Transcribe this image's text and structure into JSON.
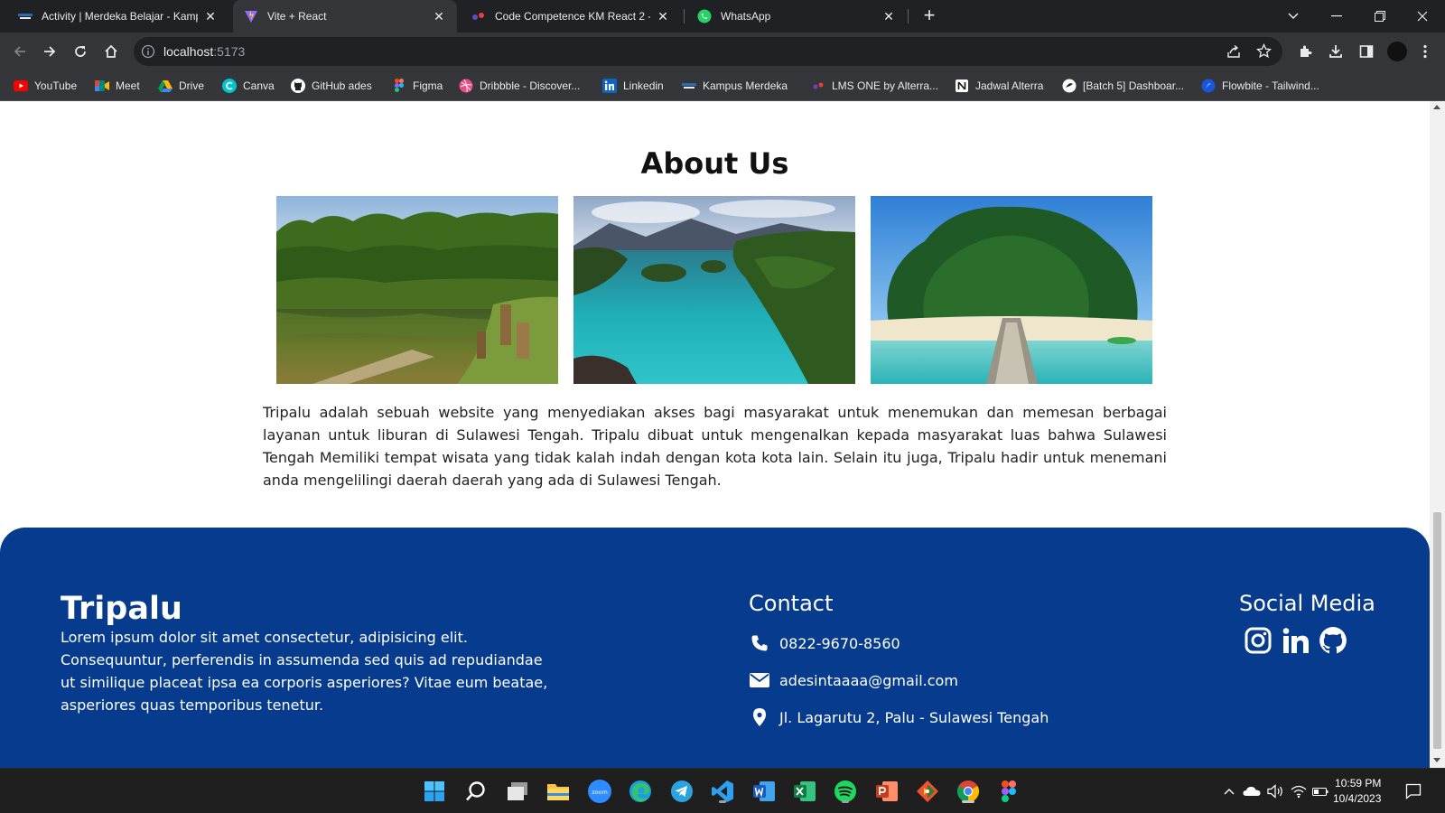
{
  "browser": {
    "tabs": [
      {
        "title": "Activity | Merdeka Belajar - Kamp",
        "favicon": "merdeka-logo",
        "active": false
      },
      {
        "title": "Vite + React",
        "favicon": "vite-logo",
        "active": true
      },
      {
        "title": "Code Competence KM React 2 -",
        "favicon": "alterra-logo",
        "active": false
      },
      {
        "title": "WhatsApp",
        "favicon": "whatsapp-logo",
        "active": false
      }
    ],
    "close_glyph": "✕",
    "new_tab_glyph": "+",
    "address": {
      "host": "localhost",
      "port": ":5173"
    },
    "bookmarks": [
      {
        "label": "YouTube",
        "icon": "youtube-icon",
        "color": "#ff0000"
      },
      {
        "label": "Meet",
        "icon": "meet-icon",
        "color": "#00897b"
      },
      {
        "label": "Drive",
        "icon": "drive-icon",
        "color": "#1fa463"
      },
      {
        "label": "Canva",
        "icon": "canva-icon",
        "color": "#00c4cc"
      },
      {
        "label": "GitHub ades",
        "icon": "github-icon",
        "color": "#ffffff"
      },
      {
        "label": "Figma",
        "icon": "figma-icon",
        "color": "#f24e1e"
      },
      {
        "label": "Dribbble - Discover...",
        "icon": "dribbble-icon",
        "color": "#ea4c89"
      },
      {
        "label": "Linkedin",
        "icon": "linkedin-icon",
        "color": "#0a66c2"
      },
      {
        "label": "Kampus Merdeka",
        "icon": "kampus-merdeka-icon",
        "color": "#2b6cb0"
      },
      {
        "label": "LMS ONE by Alterra...",
        "icon": "alterra-icon",
        "color": "#e53e3e"
      },
      {
        "label": "Jadwal Alterra",
        "icon": "notion-icon",
        "color": "#ffffff"
      },
      {
        "label": "[Batch 5] Dashboar...",
        "icon": "dashboard-icon",
        "color": "#ffffff"
      },
      {
        "label": "Flowbite - Tailwind...",
        "icon": "flowbite-icon",
        "color": "#1a56db"
      }
    ]
  },
  "page": {
    "about": {
      "title": "About Us",
      "text": "Tripalu adalah sebuah website yang menyediakan akses bagi masyarakat untuk menemukan dan memesan berbagai layanan untuk liburan di Sulawesi Tengah. Tripalu dibuat untuk mengenalkan kepada masyarakat luas bahwa Sulawesi Tengah Memiliki tempat wisata yang tidak kalah indah dengan kota kota lain. Selain itu juga, Tripalu hadir untuk menemani anda mengelilingi daerah daerah yang ada di Sulawesi Tengah."
    },
    "footer": {
      "brand": "Tripalu",
      "description": "Lorem ipsum dolor sit amet consectetur, adipisicing elit. Consequuntur, perferendis in assumenda sed quis ad repudiandae ut similique placeat ipsa ea corporis asperiores? Vitae eum beatae, asperiores quas temporibus tenetur.",
      "contact_title": "Contact",
      "phone": "0822-9670-8560",
      "email": "adesintaaaa@gmail.com",
      "address": "Jl. Lagarutu 2, Palu - Sulawesi Tengah",
      "social_title": "Social Media",
      "social": [
        "instagram-icon",
        "linkedin-icon",
        "github-icon"
      ]
    }
  },
  "taskbar": {
    "apps": [
      "windows-start-icon",
      "search-icon",
      "task-view-icon",
      "file-explorer-icon",
      "zoom-icon",
      "edge-icon",
      "telegram-icon",
      "vscode-icon",
      "word-icon",
      "excel-icon",
      "spotify-icon",
      "powerpoint-icon",
      "git-icon",
      "chrome-icon",
      "figma-icon"
    ],
    "zoom_label": "zoom",
    "time": "10:59 PM",
    "date": "10/4/2023"
  }
}
